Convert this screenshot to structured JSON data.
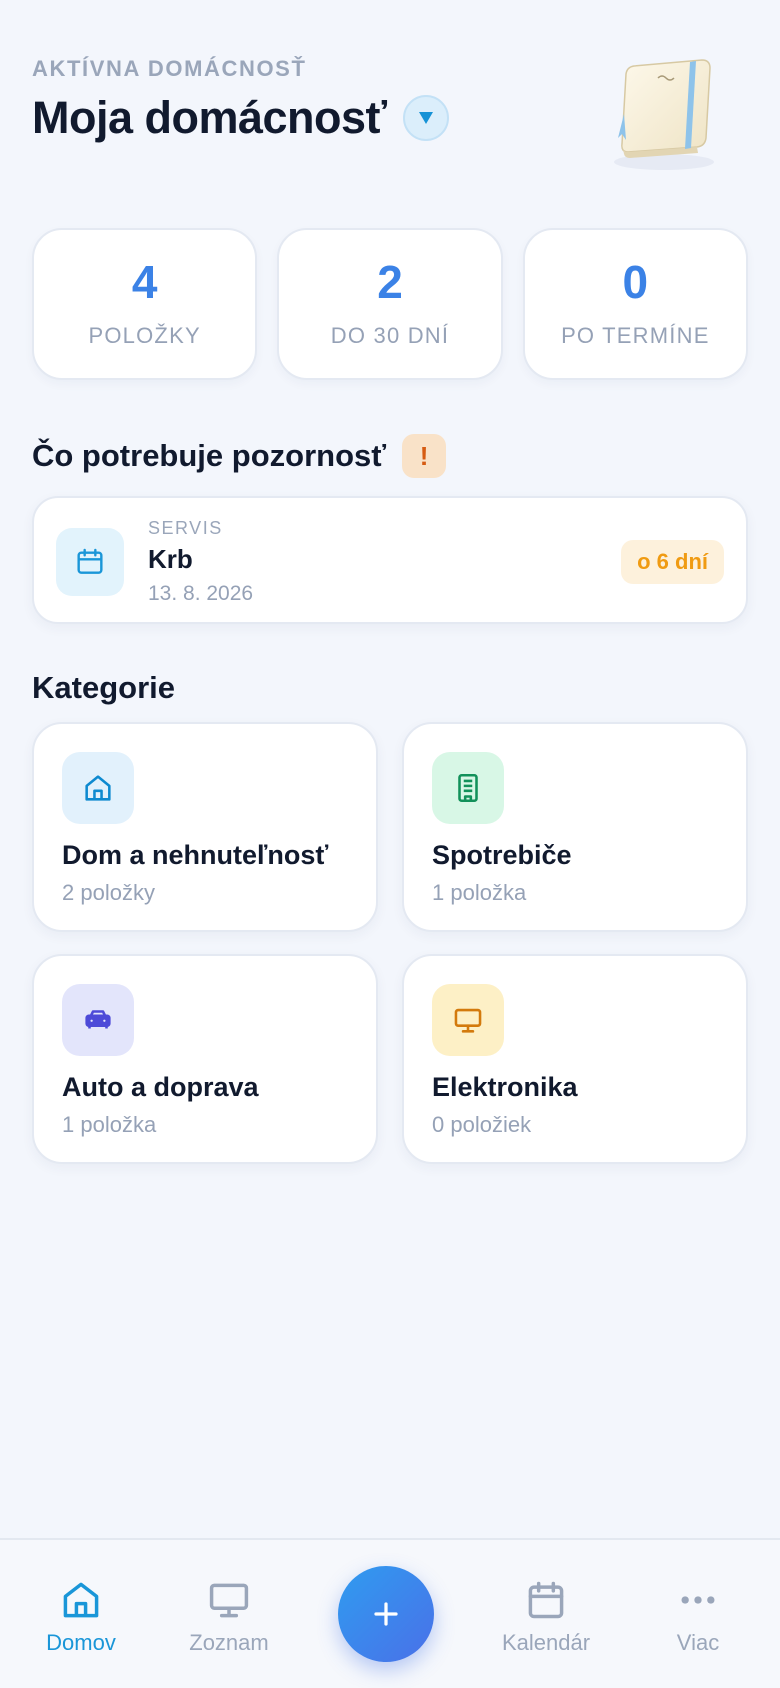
{
  "header": {
    "eyebrow": "AKTÍVNA DOMÁCNOSŤ",
    "title": "Moja domácnosť"
  },
  "stats": [
    {
      "value": "4",
      "label": "POLOŽKY"
    },
    {
      "value": "2",
      "label": "DO 30 DNÍ"
    },
    {
      "value": "0",
      "label": "PO TERMÍNE"
    }
  ],
  "attention": {
    "title": "Čo potrebuje pozornosť",
    "badge": "!",
    "item": {
      "type": "SERVIS",
      "name": "Krb",
      "date": "13. 8. 2026",
      "due": "o 6 dní"
    }
  },
  "categories": {
    "title": "Kategorie",
    "items": [
      {
        "name": "Dom a nehnuteľnosť",
        "count": "2 položky",
        "icon": "house-icon",
        "color": "#0e8ad0",
        "bg": "#e2f1fc"
      },
      {
        "name": "Spotrebiče",
        "count": "1 položka",
        "icon": "appliance-icon",
        "color": "#12915a",
        "bg": "#d8f7e6"
      },
      {
        "name": "Auto a doprava",
        "count": "1 položka",
        "icon": "car-icon",
        "color": "#4d4ad8",
        "bg": "#e3e5fb"
      },
      {
        "name": "Elektronika",
        "count": "0 položiek",
        "icon": "monitor-icon",
        "color": "#d37a0c",
        "bg": "#fdf0c6"
      }
    ]
  },
  "tabs": [
    {
      "label": "Domov",
      "icon": "home-icon",
      "active": true
    },
    {
      "label": "Zoznam",
      "icon": "monitor-icon",
      "active": false
    },
    {
      "label": "Kalendár",
      "icon": "calendar-icon",
      "active": false
    },
    {
      "label": "Viac",
      "icon": "more-icon",
      "active": false
    }
  ],
  "colors": {
    "accent": "#3b82e6",
    "active_tab": "#1a96d8",
    "warning": "#f09b12"
  }
}
